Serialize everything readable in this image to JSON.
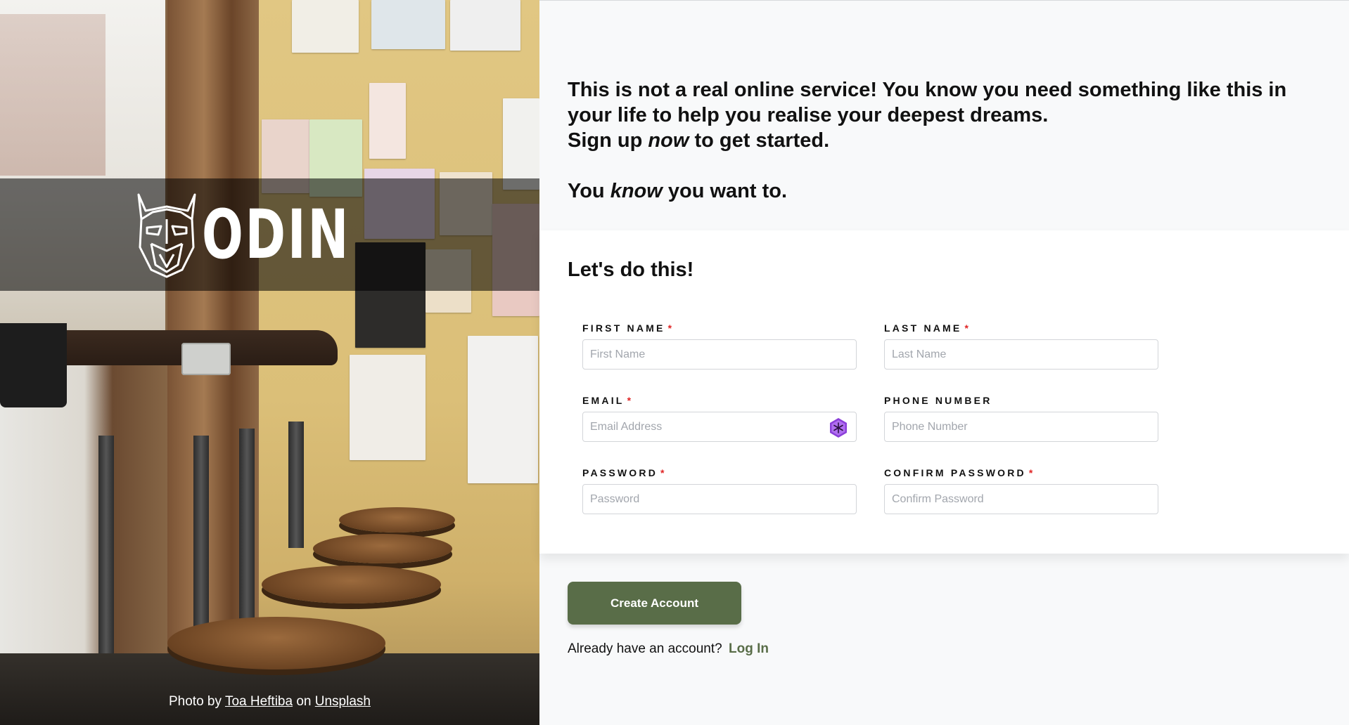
{
  "hero": {
    "logo_text": "ODIN",
    "credit_prefix": "Photo by",
    "credit_author": "Toa Heftiba",
    "credit_middle": "on",
    "credit_site": "Unsplash"
  },
  "intro": {
    "line1": "This is not a real online service! You know you need something like this in your life to help you realise your deepest dreams.",
    "line2_pre": "Sign up",
    "line2_em": "now",
    "line2_post": "to get started.",
    "line3_pre": "You",
    "line3_em": "know",
    "line3_post": "you want to."
  },
  "form": {
    "heading": "Let's do this!",
    "required_mark": "*",
    "first_name": {
      "label": "FIRST NAME",
      "placeholder": "First Name"
    },
    "last_name": {
      "label": "LAST NAME",
      "placeholder": "Last Name"
    },
    "email": {
      "label": "EMAIL",
      "placeholder": "Email Address"
    },
    "phone": {
      "label": "PHONE NUMBER",
      "placeholder": "Phone Number"
    },
    "password": {
      "label": "PASSWORD",
      "placeholder": "Password"
    },
    "confirm_password": {
      "label": "CONFIRM PASSWORD",
      "placeholder": "Confirm Password"
    }
  },
  "actions": {
    "create_label": "Create Account",
    "login_prompt": "Already have an account?",
    "login_link": "Log In"
  },
  "colors": {
    "accent": "#596d48",
    "required": "#e02424",
    "password_manager_badge": "#8b3fd9"
  }
}
